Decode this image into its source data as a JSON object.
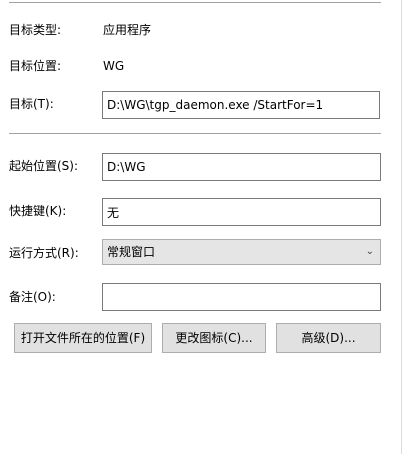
{
  "target_type": {
    "label": "目标类型:",
    "value": "应用程序"
  },
  "target_location": {
    "label": "目标位置:",
    "value": "WG"
  },
  "target": {
    "label": "目标(T):",
    "value": "D:\\WG\\tgp_daemon.exe /StartFor=1"
  },
  "start_in": {
    "label": "起始位置(S):",
    "value": "D:\\WG"
  },
  "shortcut_key": {
    "label": "快捷键(K):",
    "value": "无"
  },
  "run": {
    "label": "运行方式(R):",
    "value": "常规窗口"
  },
  "comment": {
    "label": "备注(O):",
    "value": ""
  },
  "buttons": {
    "open_location": "打开文件所在的位置(F)",
    "change_icon": "更改图标(C)...",
    "advanced": "高级(D)..."
  }
}
